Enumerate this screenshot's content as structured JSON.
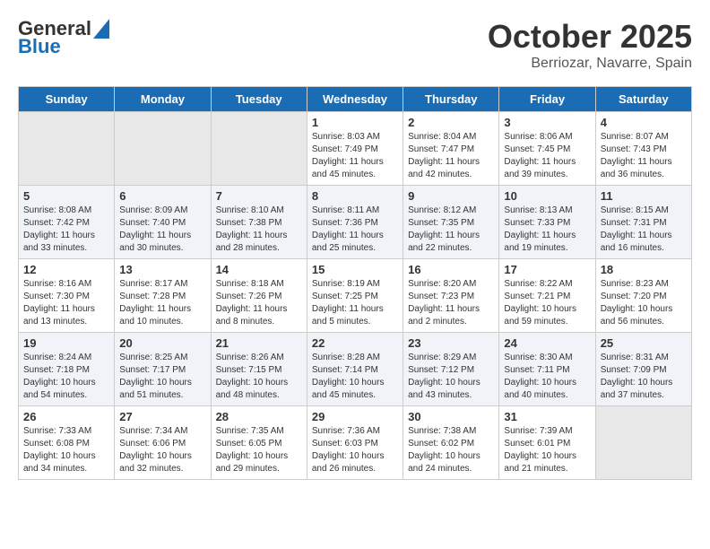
{
  "logo": {
    "line1": "General",
    "line2": "Blue"
  },
  "title": "October 2025",
  "location": "Berriozar, Navarre, Spain",
  "days_of_week": [
    "Sunday",
    "Monday",
    "Tuesday",
    "Wednesday",
    "Thursday",
    "Friday",
    "Saturday"
  ],
  "weeks": [
    [
      {
        "day": "",
        "content": ""
      },
      {
        "day": "",
        "content": ""
      },
      {
        "day": "",
        "content": ""
      },
      {
        "day": "1",
        "content": "Sunrise: 8:03 AM\nSunset: 7:49 PM\nDaylight: 11 hours\nand 45 minutes."
      },
      {
        "day": "2",
        "content": "Sunrise: 8:04 AM\nSunset: 7:47 PM\nDaylight: 11 hours\nand 42 minutes."
      },
      {
        "day": "3",
        "content": "Sunrise: 8:06 AM\nSunset: 7:45 PM\nDaylight: 11 hours\nand 39 minutes."
      },
      {
        "day": "4",
        "content": "Sunrise: 8:07 AM\nSunset: 7:43 PM\nDaylight: 11 hours\nand 36 minutes."
      }
    ],
    [
      {
        "day": "5",
        "content": "Sunrise: 8:08 AM\nSunset: 7:42 PM\nDaylight: 11 hours\nand 33 minutes."
      },
      {
        "day": "6",
        "content": "Sunrise: 8:09 AM\nSunset: 7:40 PM\nDaylight: 11 hours\nand 30 minutes."
      },
      {
        "day": "7",
        "content": "Sunrise: 8:10 AM\nSunset: 7:38 PM\nDaylight: 11 hours\nand 28 minutes."
      },
      {
        "day": "8",
        "content": "Sunrise: 8:11 AM\nSunset: 7:36 PM\nDaylight: 11 hours\nand 25 minutes."
      },
      {
        "day": "9",
        "content": "Sunrise: 8:12 AM\nSunset: 7:35 PM\nDaylight: 11 hours\nand 22 minutes."
      },
      {
        "day": "10",
        "content": "Sunrise: 8:13 AM\nSunset: 7:33 PM\nDaylight: 11 hours\nand 19 minutes."
      },
      {
        "day": "11",
        "content": "Sunrise: 8:15 AM\nSunset: 7:31 PM\nDaylight: 11 hours\nand 16 minutes."
      }
    ],
    [
      {
        "day": "12",
        "content": "Sunrise: 8:16 AM\nSunset: 7:30 PM\nDaylight: 11 hours\nand 13 minutes."
      },
      {
        "day": "13",
        "content": "Sunrise: 8:17 AM\nSunset: 7:28 PM\nDaylight: 11 hours\nand 10 minutes."
      },
      {
        "day": "14",
        "content": "Sunrise: 8:18 AM\nSunset: 7:26 PM\nDaylight: 11 hours\nand 8 minutes."
      },
      {
        "day": "15",
        "content": "Sunrise: 8:19 AM\nSunset: 7:25 PM\nDaylight: 11 hours\nand 5 minutes."
      },
      {
        "day": "16",
        "content": "Sunrise: 8:20 AM\nSunset: 7:23 PM\nDaylight: 11 hours\nand 2 minutes."
      },
      {
        "day": "17",
        "content": "Sunrise: 8:22 AM\nSunset: 7:21 PM\nDaylight: 10 hours\nand 59 minutes."
      },
      {
        "day": "18",
        "content": "Sunrise: 8:23 AM\nSunset: 7:20 PM\nDaylight: 10 hours\nand 56 minutes."
      }
    ],
    [
      {
        "day": "19",
        "content": "Sunrise: 8:24 AM\nSunset: 7:18 PM\nDaylight: 10 hours\nand 54 minutes."
      },
      {
        "day": "20",
        "content": "Sunrise: 8:25 AM\nSunset: 7:17 PM\nDaylight: 10 hours\nand 51 minutes."
      },
      {
        "day": "21",
        "content": "Sunrise: 8:26 AM\nSunset: 7:15 PM\nDaylight: 10 hours\nand 48 minutes."
      },
      {
        "day": "22",
        "content": "Sunrise: 8:28 AM\nSunset: 7:14 PM\nDaylight: 10 hours\nand 45 minutes."
      },
      {
        "day": "23",
        "content": "Sunrise: 8:29 AM\nSunset: 7:12 PM\nDaylight: 10 hours\nand 43 minutes."
      },
      {
        "day": "24",
        "content": "Sunrise: 8:30 AM\nSunset: 7:11 PM\nDaylight: 10 hours\nand 40 minutes."
      },
      {
        "day": "25",
        "content": "Sunrise: 8:31 AM\nSunset: 7:09 PM\nDaylight: 10 hours\nand 37 minutes."
      }
    ],
    [
      {
        "day": "26",
        "content": "Sunrise: 7:33 AM\nSunset: 6:08 PM\nDaylight: 10 hours\nand 34 minutes."
      },
      {
        "day": "27",
        "content": "Sunrise: 7:34 AM\nSunset: 6:06 PM\nDaylight: 10 hours\nand 32 minutes."
      },
      {
        "day": "28",
        "content": "Sunrise: 7:35 AM\nSunset: 6:05 PM\nDaylight: 10 hours\nand 29 minutes."
      },
      {
        "day": "29",
        "content": "Sunrise: 7:36 AM\nSunset: 6:03 PM\nDaylight: 10 hours\nand 26 minutes."
      },
      {
        "day": "30",
        "content": "Sunrise: 7:38 AM\nSunset: 6:02 PM\nDaylight: 10 hours\nand 24 minutes."
      },
      {
        "day": "31",
        "content": "Sunrise: 7:39 AM\nSunset: 6:01 PM\nDaylight: 10 hours\nand 21 minutes."
      },
      {
        "day": "",
        "content": ""
      }
    ]
  ]
}
